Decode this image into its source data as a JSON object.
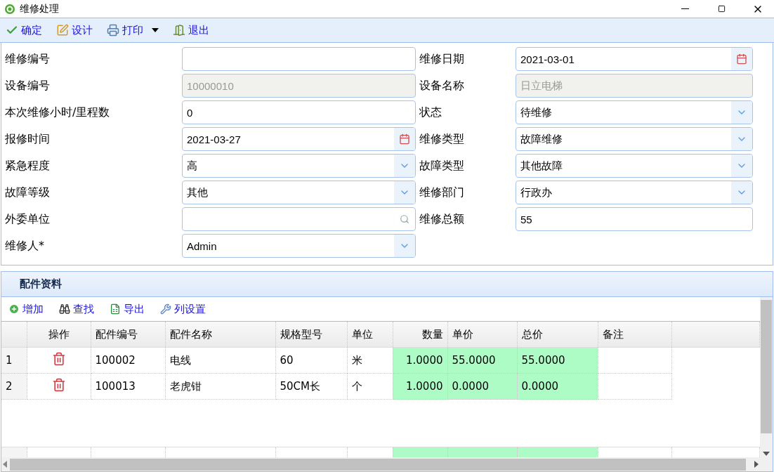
{
  "window": {
    "title": "维修处理"
  },
  "toolbar": [
    {
      "kind": "confirm",
      "label": "确定"
    },
    {
      "kind": "design",
      "label": "设计"
    },
    {
      "kind": "print",
      "label": "打印",
      "dropdown": true
    },
    {
      "kind": "exit",
      "label": "退出"
    }
  ],
  "form": {
    "fields": [
      {
        "label": "维修编号",
        "kind": "text",
        "disabled": false
      },
      {
        "label": "维修日期",
        "kind": "date",
        "value": "2021-03-01",
        "disabled": false
      },
      {
        "label": "设备编号",
        "kind": "text",
        "value": "10000010",
        "disabled": true
      },
      {
        "label": "设备名称",
        "kind": "text",
        "value": "日立电梯",
        "disabled": true
      },
      {
        "label": "本次维修小时/里程数",
        "kind": "text",
        "value": "0",
        "disabled": false
      },
      {
        "label": "状态",
        "kind": "select",
        "value": "待维修",
        "disabled": false
      },
      {
        "label": "报修时间",
        "kind": "date",
        "value": "2021-03-27",
        "disabled": false
      },
      {
        "label": "维修类型",
        "kind": "select",
        "value": "故障维修",
        "disabled": false
      },
      {
        "label": "紧急程度",
        "kind": "select",
        "value": "高",
        "disabled": false
      },
      {
        "label": "故障类型",
        "kind": "select",
        "value": "其他故障",
        "disabled": false
      },
      {
        "label": "故障等级",
        "kind": "select",
        "value": "其他",
        "disabled": false
      },
      {
        "label": "维修部门",
        "kind": "select",
        "value": "行政办",
        "disabled": false
      },
      {
        "label": "外委单位",
        "kind": "lookup",
        "disabled": false
      },
      {
        "label": "维修总额",
        "kind": "text",
        "value": "55",
        "disabled": false
      },
      {
        "label": "维修人*",
        "kind": "select",
        "value": "Admin",
        "disabled": false
      }
    ]
  },
  "parts": {
    "title": "配件资料",
    "toolbar": [
      {
        "kind": "add",
        "label": "增加"
      },
      {
        "kind": "find",
        "label": "查找"
      },
      {
        "kind": "export",
        "label": "导出"
      },
      {
        "kind": "columns",
        "label": "列设置"
      }
    ],
    "columns": [
      {
        "kind": "row_number"
      },
      {
        "label": "操作",
        "kind": "action"
      },
      {
        "label": "配件编号",
        "kind": "text"
      },
      {
        "label": "配件名称",
        "kind": "text"
      },
      {
        "label": "规格型号",
        "kind": "text"
      },
      {
        "label": "单位",
        "kind": "text"
      },
      {
        "label": "数量",
        "kind": "quantity",
        "editable": true
      },
      {
        "label": "单价",
        "kind": "text",
        "editable": true
      },
      {
        "label": "总价",
        "kind": "text",
        "editable": true
      },
      {
        "label": "备注",
        "kind": "text"
      }
    ],
    "rows": [
      {
        "cells": [
          "1",
          "",
          "100002",
          "电线",
          "60",
          "米",
          "1.0000",
          "55.0000",
          "55.0000"
        ]
      },
      {
        "cells": [
          "2",
          "",
          "100013",
          "老虎钳",
          "50CM长",
          "个",
          "1.0000",
          "0.0000",
          "0.0000"
        ]
      }
    ]
  }
}
